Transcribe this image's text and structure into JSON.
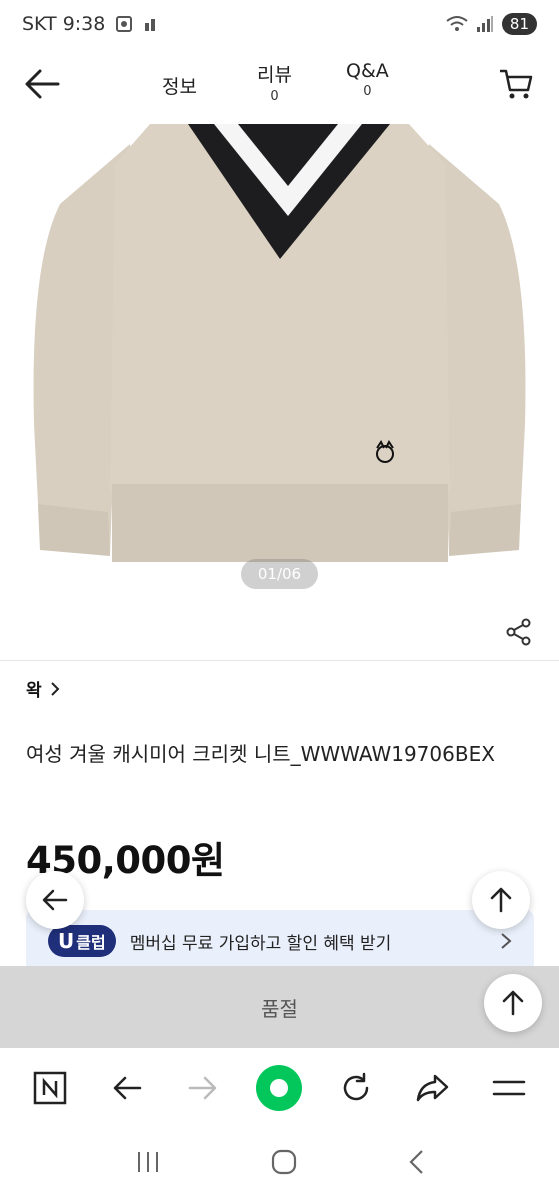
{
  "status_bar": {
    "carrier_time": "SKT 9:38",
    "battery": "81"
  },
  "header": {
    "tabs": [
      {
        "label": "정보",
        "count": ""
      },
      {
        "label": "리뷰",
        "count": "0"
      },
      {
        "label": "Q&A",
        "count": "0"
      }
    ]
  },
  "gallery": {
    "pager": "01/06"
  },
  "product": {
    "brand": "왁",
    "title": "여성 겨울 캐시미어 크리켓 니트_WWWAW19706BEX",
    "price": "450,000원"
  },
  "membership_banner": {
    "badge_letter": "U",
    "badge_text": "클럽",
    "text": "멤버십 무료 가입하고 할인 혜택 받기"
  },
  "bottom": {
    "soldout_label": "품절"
  },
  "colors": {
    "accent_green": "#03c75a",
    "uclub_navy": "#1f2f7a",
    "banner_bg": "#eaf0fb",
    "soldout_bg": "#d6d6d6"
  },
  "icons": [
    "back-arrow-icon",
    "cart-icon",
    "share-icon",
    "chevron-right-icon",
    "arrow-up-icon",
    "naver-n-icon",
    "forward-icon",
    "refresh-icon",
    "share-arrow-icon",
    "menu-icon",
    "recents-icon",
    "home-icon"
  ]
}
